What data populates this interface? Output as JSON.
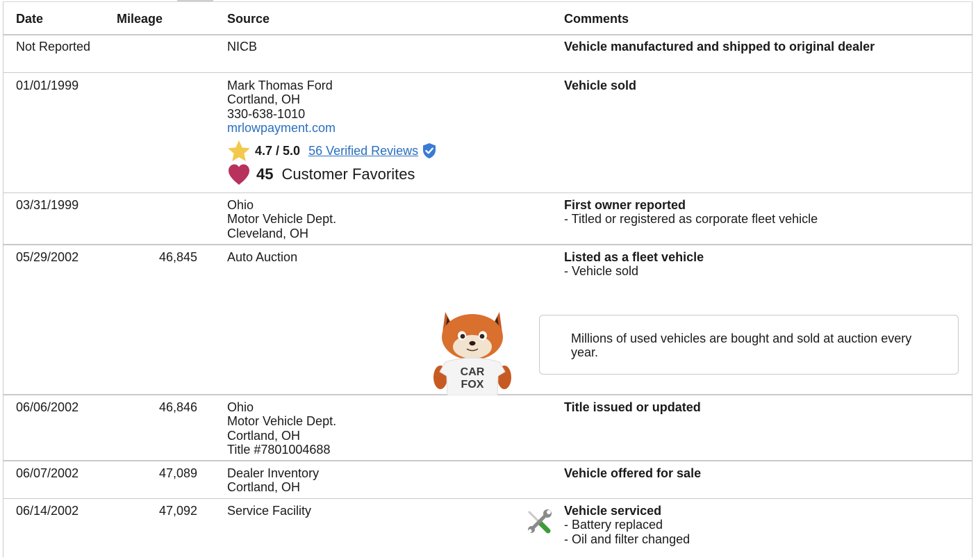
{
  "header": {
    "date": "Date",
    "mileage": "Mileage",
    "source": "Source",
    "comments": "Comments"
  },
  "rows": [
    {
      "date": "Not Reported",
      "mileage": "",
      "source": [
        "NICB"
      ],
      "comment_title": "Vehicle manufactured and shipped to original dealer",
      "comment_lines": []
    },
    {
      "date": "01/01/1999",
      "mileage": "",
      "source": [
        "Mark Thomas Ford",
        "Cortland, OH",
        "330-638-1010"
      ],
      "source_link": "mrlowpayment.com",
      "rating": "4.7 / 5.0",
      "reviews_link": "56 Verified Reviews",
      "favorites_count": "45",
      "favorites_label": "Customer Favorites",
      "comment_title": "Vehicle sold",
      "comment_lines": []
    },
    {
      "date": "03/31/1999",
      "mileage": "",
      "source": [
        "Ohio",
        "Motor Vehicle Dept.",
        "Cleveland, OH"
      ],
      "comment_title": "First owner reported",
      "comment_lines": [
        "- Titled or registered as corporate fleet vehicle"
      ]
    },
    {
      "date": "05/29/2002",
      "mileage": "46,845",
      "source": [
        "Auto Auction"
      ],
      "comment_title": "Listed as a fleet vehicle",
      "comment_lines": [
        "- Vehicle sold"
      ],
      "callout": "Millions of used vehicles are bought and sold at auction every year.",
      "fox_shirt": [
        "CAR",
        "FOX"
      ]
    },
    {
      "date": "06/06/2002",
      "mileage": "46,846",
      "source": [
        "Ohio",
        "Motor Vehicle Dept.",
        "Cortland, OH",
        "Title #7801004688"
      ],
      "comment_title": "Title issued or updated",
      "comment_lines": []
    },
    {
      "date": "06/07/2002",
      "mileage": "47,089",
      "source": [
        "Dealer Inventory",
        "Cortland, OH"
      ],
      "comment_title": "Vehicle offered for sale",
      "comment_lines": []
    },
    {
      "date": "06/14/2002",
      "mileage": "47,092",
      "source": [
        "Service Facility"
      ],
      "comment_title": "Vehicle serviced",
      "comment_lines": [
        "- Battery replaced",
        "- Oil and filter changed"
      ]
    }
  ],
  "icons": {
    "rating": "star-icon",
    "verified": "verified-shield-icon",
    "favorites": "heart-icon",
    "service": "wrench-screwdriver-icon",
    "mascot": "carfox-mascot"
  },
  "colors": {
    "link": "#2a6fbd",
    "star": "#f2c94c",
    "heart": "#b8325e",
    "shield": "#3a7bd5",
    "border": "#c9c9c9"
  }
}
